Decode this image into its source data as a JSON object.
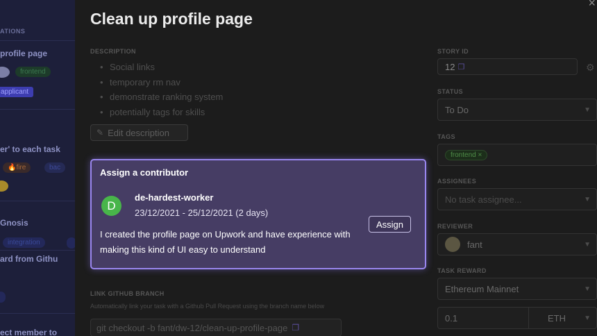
{
  "background": {
    "section_label": "ATIONS",
    "task1_title": "profile page",
    "task1_chip": "frontend",
    "task1_applicant": "applicant",
    "task2_title": "er' to each task",
    "task2_chip_fire": "🔥fire",
    "task2_chip_b": "bac",
    "task3_title": "Gnosis",
    "task3_chip": "integration",
    "task4_title": "ard from Githu",
    "task5_title": "ect member to"
  },
  "modal": {
    "close_icon": "×",
    "title": "Clean up profile page"
  },
  "description": {
    "label": "DESCRIPTION",
    "items": [
      "Social links",
      "temporary rm nav",
      "demonstrate ranking system",
      "potentially tags for skills"
    ],
    "edit_label": "Edit description"
  },
  "assign": {
    "heading": "Assign a contributor",
    "avatar_letter": "D",
    "name": "de-hardest-worker",
    "dates": "23/12/2021 - 25/12/2021 (2 days)",
    "message": "I created the profile page on Upwork and have experience with making this kind of UI easy to understand",
    "button": "Assign"
  },
  "github": {
    "label": "LINK GITHUB BRANCH",
    "subtext": "Automatically link your task with a Github Pull Request using the branch name below",
    "branch": "git checkout -b fant/dw-12/clean-up-profile-page"
  },
  "sidebar": {
    "story_id_label": "STORY ID",
    "story_id": "12",
    "status_label": "STATUS",
    "status": "To Do",
    "tags_label": "TAGS",
    "tag": "frontend",
    "assignees_label": "ASSIGNEES",
    "assignees_placeholder": "No task assignee...",
    "reviewer_label": "REVIEWER",
    "reviewer": "fant",
    "reward_label": "TASK REWARD",
    "network": "Ethereum Mainnet",
    "amount": "0.1",
    "token": "ETH"
  },
  "colors": {
    "accent": "#9a87f0",
    "panel_bg": "#463d64",
    "avatar_green": "#48b54a"
  }
}
